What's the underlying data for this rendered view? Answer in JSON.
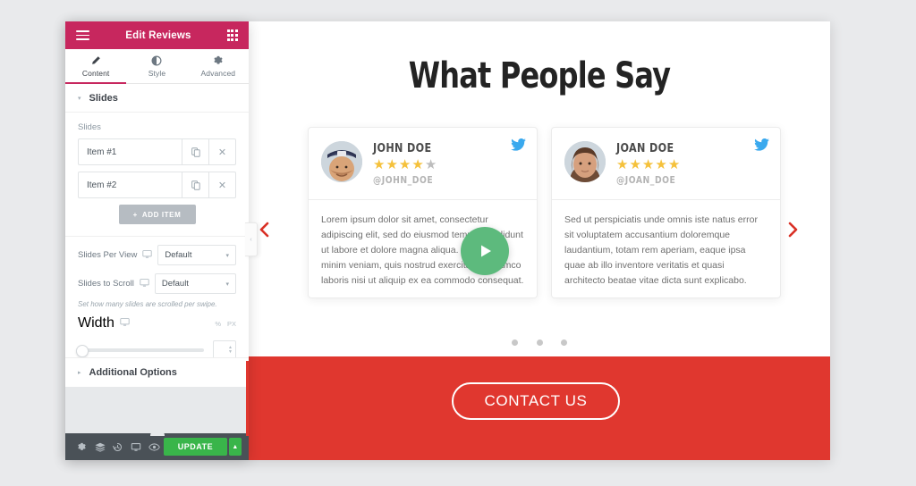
{
  "panel": {
    "header": {
      "title": "Edit Reviews",
      "menu_icon": "hamburger-menu-icon",
      "grid_icon": "widgets-grid-icon"
    },
    "tabs": [
      {
        "label": "Content",
        "icon": "pencil-icon",
        "active": true
      },
      {
        "label": "Style",
        "icon": "contrast-circle-icon",
        "active": false
      },
      {
        "label": "Advanced",
        "icon": "gear-icon",
        "active": false
      }
    ],
    "section": {
      "title": "Slides",
      "caret": "▾"
    },
    "repeater": {
      "label": "Slides",
      "items": [
        {
          "title": "Item #1",
          "duplicate_icon": "duplicate-icon",
          "remove_icon": "close-icon"
        },
        {
          "title": "Item #2",
          "duplicate_icon": "duplicate-icon",
          "remove_icon": "close-icon"
        }
      ],
      "add_label": "ADD ITEM",
      "add_plus": "+"
    },
    "controls": [
      {
        "label": "Slides Per View",
        "device_icon": "desktop-icon",
        "value": "Default",
        "caret": "▾"
      },
      {
        "label": "Slides to Scroll",
        "device_icon": "desktop-icon",
        "value": "Default",
        "caret": "▾"
      }
    ],
    "hint": "Set how many slides are scrolled per swipe.",
    "width": {
      "label": "Width",
      "device_icon": "desktop-icon",
      "unit_percent": "%",
      "unit_px": "PX",
      "value": ""
    },
    "additional_options": {
      "title": "Additional Options",
      "caret": "▸"
    },
    "footer": {
      "icons": [
        {
          "name": "settings-gear-icon",
          "glyph": "⚙"
        },
        {
          "name": "navigator-layers-icon",
          "glyph": "☰"
        },
        {
          "name": "history-icon",
          "glyph": "↺"
        },
        {
          "name": "responsive-mode-icon",
          "glyph": "▭"
        },
        {
          "name": "preview-eye-icon",
          "glyph": "◉"
        }
      ],
      "update_label": "UPDATE",
      "update_caret": "▲"
    },
    "collapse_handle": "‹"
  },
  "preview": {
    "title": "What People Say",
    "prev_arrow": "‹",
    "next_arrow": "›",
    "play_icon": "play-triangle-icon",
    "dots": [
      {
        "active": false
      },
      {
        "active": false
      },
      {
        "active": false
      }
    ],
    "cards": [
      {
        "name": "JOHN DOE",
        "handle": "@JOHN_DOE",
        "rating": 4,
        "max_rating": 5,
        "social_icon": "twitter-bird-icon",
        "avatar": "photo-man-with-cap",
        "text": "Lorem ipsum dolor sit amet, consectetur adipiscing elit, sed do eiusmod tempor incididunt ut labore et dolore magna aliqua. Ut enim ad minim veniam, quis nostrud exercitation ullamco laboris nisi ut aliquip ex ea commodo consequat."
      },
      {
        "name": "JOAN DOE",
        "handle": "@JOAN_DOE",
        "rating": 5,
        "max_rating": 5,
        "social_icon": "twitter-bird-icon",
        "avatar": "photo-woman",
        "text": "Sed ut perspiciatis unde omnis iste natus error sit voluptatem accusantium doloremque laudantium, totam rem aperiam, eaque ipsa quae ab illo inventore veritatis et quasi architecto beatae vitae dicta sunt explicabo."
      }
    ],
    "cta": {
      "label": "CONTACT US"
    }
  },
  "colors": {
    "panel_header": "#c7275e",
    "accent_red": "#e0372f",
    "update_green": "#39b54a",
    "play_green": "#5dba7d",
    "star_gold": "#f5c13b",
    "star_empty": "#bdbdbd",
    "twitter_blue": "#3aa9ee"
  }
}
